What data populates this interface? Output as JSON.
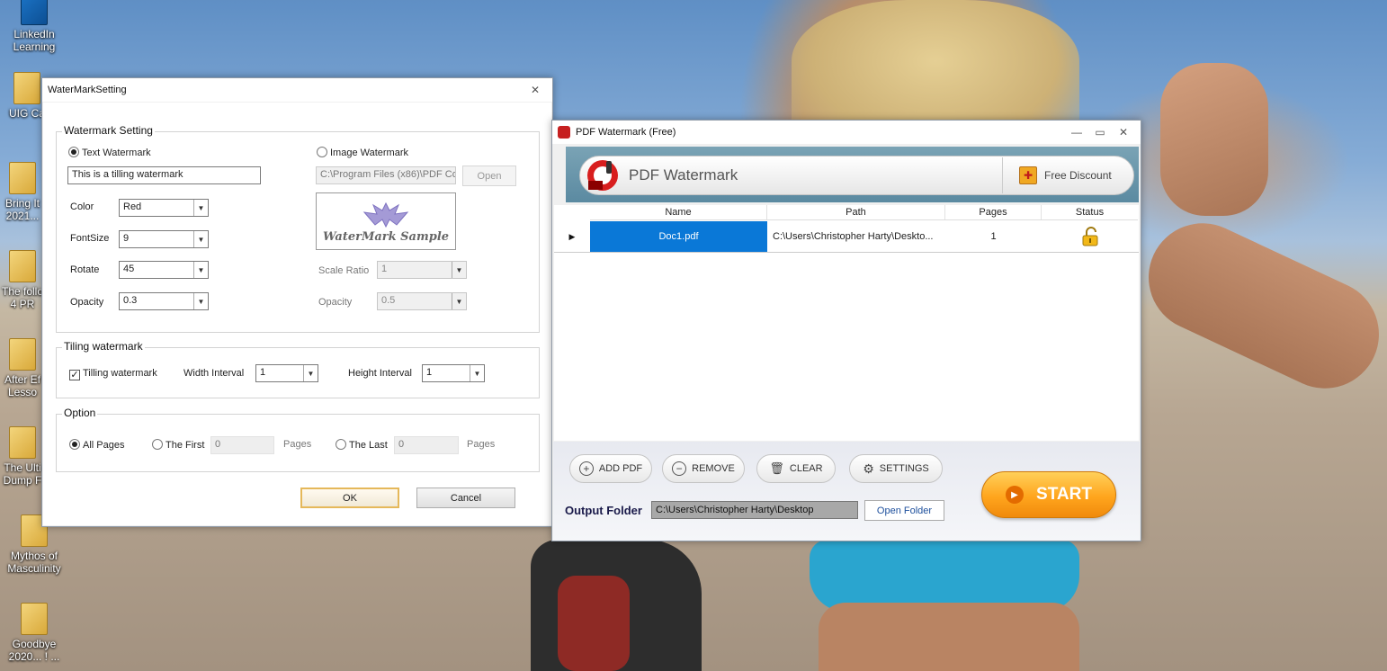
{
  "desktop": {
    "icons": [
      {
        "label": "LinkedIn\nLearning"
      },
      {
        "label": "UIG Ca"
      },
      {
        "label": "Bring It\n2021..."
      },
      {
        "label": "The follo\n4 PR"
      },
      {
        "label": "After Ef\nLesso"
      },
      {
        "label": "The Ulti\nDump F"
      },
      {
        "label": "Mythos of\nMasculinity"
      },
      {
        "label": "Goodbye\n2020... ! ..."
      }
    ]
  },
  "wm_dialog": {
    "title": "WaterMarkSetting",
    "close_icon": "close-icon",
    "watermark_setting": {
      "group_label": "Watermark Setting",
      "text_watermark_label": "Text Watermark",
      "text_value": "This is a tilling watermark",
      "image_watermark_label": "Image Watermark",
      "image_path": "C:\\Program Files (x86)\\PDF Co",
      "open_label": "Open",
      "color_label": "Color",
      "color_value": "Red",
      "fontsize_label": "FontSize",
      "fontsize_value": "9",
      "rotate_label": "Rotate",
      "rotate_value": "45",
      "opacity_label": "Opacity",
      "opacity_value": "0.3",
      "sample_text": "WaterMark Sample",
      "scale_ratio_label": "Scale Ratio",
      "scale_ratio_value": "1",
      "image_opacity_label": "Opacity",
      "image_opacity_value": "0.5"
    },
    "tiling": {
      "group_label": "Tiling watermark",
      "checkbox_label": "Tilling watermark",
      "width_label": "Width Interval",
      "width_value": "1",
      "height_label": "Height Interval",
      "height_value": "1"
    },
    "option": {
      "group_label": "Option",
      "all_pages": "All Pages",
      "the_first": "The First",
      "first_value": "0",
      "pages1": "Pages",
      "the_last": "The Last",
      "last_value": "0",
      "pages2": "Pages"
    },
    "ok_label": "OK",
    "cancel_label": "Cancel"
  },
  "pdf_window": {
    "title": "PDF Watermark (Free)",
    "banner_title": "PDF Watermark",
    "discount_label": "Free Discount",
    "columns": [
      "Name",
      "Path",
      "Pages",
      "Status"
    ],
    "rows": [
      {
        "name": "Doc1.pdf",
        "path": "C:\\Users\\Christopher Harty\\Deskto...",
        "pages": "1",
        "status": "unlocked-icon"
      }
    ],
    "buttons": {
      "add": "ADD PDF",
      "remove": "REMOVE",
      "clear": "CLEAR",
      "settings": "SETTINGS"
    },
    "output_label": "Output Folder",
    "output_path": "C:\\Users\\Christopher Harty\\Desktop",
    "open_folder": "Open Folder",
    "start": "START"
  }
}
